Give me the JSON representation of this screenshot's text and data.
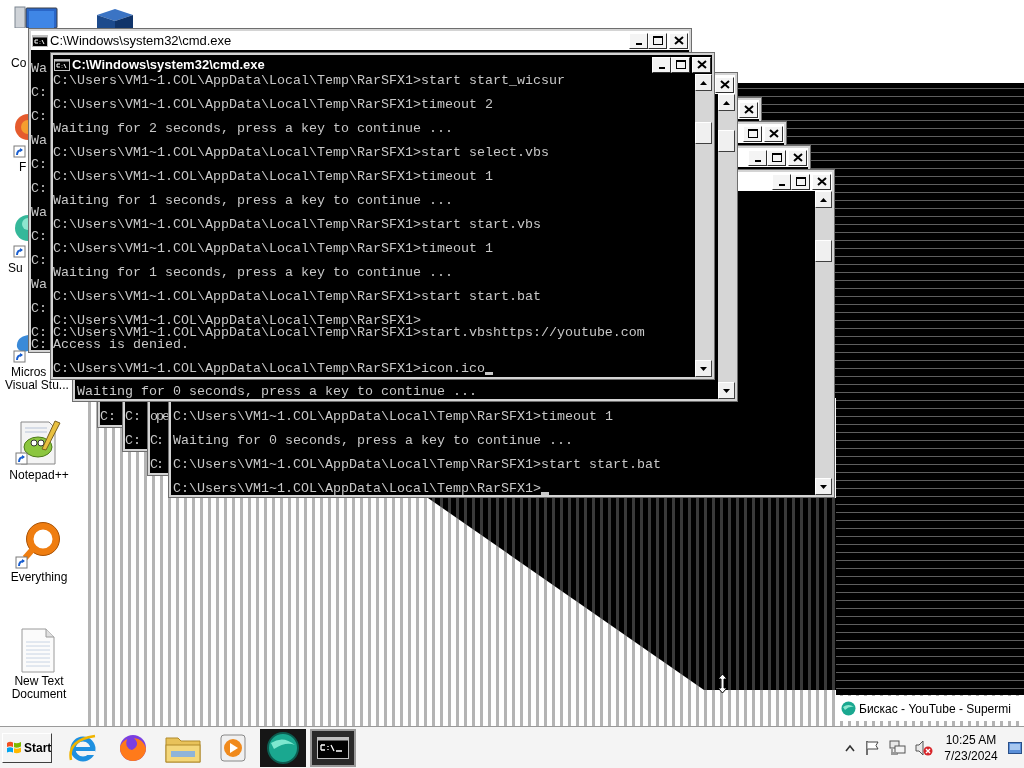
{
  "desktop_icons": [
    {
      "kind": "computer",
      "lines": [
        "Co"
      ]
    },
    {
      "kind": "cube"
    },
    {
      "kind": "fireball",
      "lines": [
        "F"
      ]
    },
    {
      "kind": "orb",
      "lines": [
        "Su"
      ]
    },
    {
      "kind": "swirl",
      "lines": [
        "Micros",
        "Visual Stu..."
      ]
    },
    {
      "kind": "notepad",
      "lines": [
        "Notepad++"
      ]
    },
    {
      "kind": "magnifier",
      "lines": [
        "Everything"
      ]
    },
    {
      "kind": "document",
      "lines": [
        "New Text",
        "Document"
      ]
    }
  ],
  "windows": [
    {
      "title": "C:\\Windows\\system32\\cmd.exe",
      "active": false,
      "buttons": [
        {
          "kind": "minimize"
        },
        {
          "kind": "maximize"
        },
        {
          "kind": "close"
        }
      ],
      "lines": [
        "Wa",
        "C:",
        "C:",
        "Wa",
        "C:",
        "C:",
        "Wa",
        "C:",
        "C:",
        "Wa",
        "C:",
        "C:",
        "C:"
      ]
    },
    {
      "title": "C:\\Windows\\system32\\cmd.exe",
      "active": true,
      "buttons": [
        {
          "kind": "minimize"
        },
        {
          "kind": "maximize"
        },
        {
          "kind": "close"
        }
      ],
      "lines": [
        "C:\\Users\\VM1~1.COL\\AppData\\Local\\Temp\\RarSFX1>start start_wicsur",
        "C:\\Users\\VM1~1.COL\\AppData\\Local\\Temp\\RarSFX1>timeout 2",
        "Waiting for 2 seconds, press a key to continue ...",
        "C:\\Users\\VM1~1.COL\\AppData\\Local\\Temp\\RarSFX1>start select.vbs",
        "C:\\Users\\VM1~1.COL\\AppData\\Local\\Temp\\RarSFX1>timeout 1",
        "Waiting for 1 seconds, press a key to continue ...",
        "C:\\Users\\VM1~1.COL\\AppData\\Local\\Temp\\RarSFX1>start start.vbs",
        "C:\\Users\\VM1~1.COL\\AppData\\Local\\Temp\\RarSFX1>timeout 1",
        "Waiting for 1 seconds, press a key to continue ...",
        "C:\\Users\\VM1~1.COL\\AppData\\Local\\Temp\\RarSFX1>start start.bat",
        "C:\\Users\\VM1~1.COL\\AppData\\Local\\Temp\\RarSFX1>",
        "C:\\Users\\VM1~1.COL\\AppData\\Local\\Temp\\RarSFX1>start.vbshttps://youtube.com",
        "Access is denied.",
        "C:\\Users\\VM1~1.COL\\AppData\\Local\\Temp\\RarSFX1>icon.ico"
      ],
      "cursor": true
    },
    {
      "buttons": [
        {
          "kind": "close"
        }
      ],
      "lines": [
        "Waiting for 0 seconds, press a key to continue ..."
      ]
    },
    {
      "buttons": [
        {
          "kind": "close"
        }
      ],
      "lines": [
        "C:"
      ]
    },
    {
      "buttons": [
        {
          "kind": "maximize"
        },
        {
          "kind": "close"
        }
      ],
      "lines": [
        "C:",
        "C:"
      ]
    },
    {
      "buttons": [
        {
          "kind": "minimize"
        },
        {
          "kind": "maximize"
        },
        {
          "kind": "close"
        }
      ],
      "lines": [
        "ope",
        "C:",
        "C:"
      ]
    },
    {
      "buttons": [
        {
          "kind": "minimize"
        },
        {
          "kind": "maximize"
        },
        {
          "kind": "close"
        }
      ],
      "lines": [
        "C:\\Users\\VM1~1.COL\\AppData\\Local\\Temp\\RarSFX1>timeout 1",
        "Waiting for 0 seconds, press a key to continue ...",
        "C:\\Users\\VM1~1.COL\\AppData\\Local\\Temp\\RarSFX1>start start.bat",
        "C:\\Users\\VM1~1.COL\\AppData\\Local\\Temp\\RarSFX1>"
      ],
      "cursor": true
    }
  ],
  "browser_window": {
    "title": "Бискас - YouTube - Supermi"
  },
  "taskbar": {
    "start_button": {
      "label": "Start"
    },
    "items": [
      {
        "kind": "ering",
        "running": false,
        "selected": false
      },
      {
        "kind": "flameglobe",
        "running": false,
        "selected": false
      },
      {
        "kind": "folder",
        "running": false,
        "selected": false
      },
      {
        "kind": "player",
        "running": false,
        "selected": false
      },
      {
        "kind": "orb",
        "running": true,
        "selected": false
      },
      {
        "kind": "terminal",
        "running": true,
        "selected": true
      }
    ],
    "tray": [
      {
        "kind": "chevron"
      },
      {
        "kind": "flag"
      },
      {
        "kind": "network"
      },
      {
        "kind": "speaker_muted"
      }
    ],
    "clock": {
      "time": "10:25 AM",
      "date": "7/23/2024"
    }
  }
}
